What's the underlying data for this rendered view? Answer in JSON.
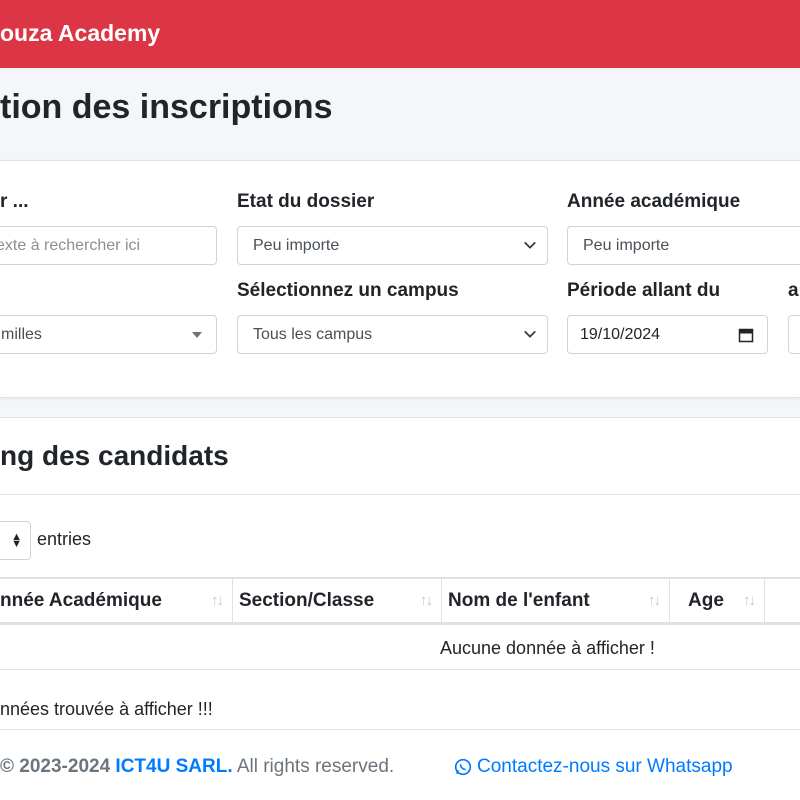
{
  "header": {
    "brand": "ouza Academy",
    "accent_color": "#dc3545"
  },
  "page": {
    "title": "tion des inscriptions"
  },
  "filters": {
    "search": {
      "label": "r ...",
      "placeholder": "exte à rechercher ici"
    },
    "etat": {
      "label": "Etat du dossier",
      "value": "Peu importe"
    },
    "annee": {
      "label": "Année académique",
      "value": "Peu importe"
    },
    "type": {
      "value": "milles"
    },
    "campus": {
      "label": "Sélectionnez un campus",
      "value": "Tous les campus"
    },
    "periode": {
      "label": "Période allant du",
      "value": "19/10/2024"
    },
    "periode_to": {
      "label": "a"
    }
  },
  "listing": {
    "title": "ng des candidats",
    "entries_label": "entries",
    "columns": [
      {
        "label": "nnée Académique"
      },
      {
        "label": "Section/Classe"
      },
      {
        "label": "Nom de l'enfant"
      },
      {
        "label": "Age"
      }
    ],
    "empty_message": "Aucune donnée à afficher !",
    "info": "nnées trouvée à afficher !!!"
  },
  "footer": {
    "copyright": "© 2023-2024 ",
    "company": "ICT4U SARL.",
    "rights": " All rights reserved.",
    "whatsapp": "Contactez-nous sur Whatsapp",
    "link_color": "#007bff"
  },
  "icons": [
    "chevron-down-icon",
    "caret-down-icon",
    "calendar-icon",
    "sort-icon",
    "whatsapp-icon"
  ]
}
